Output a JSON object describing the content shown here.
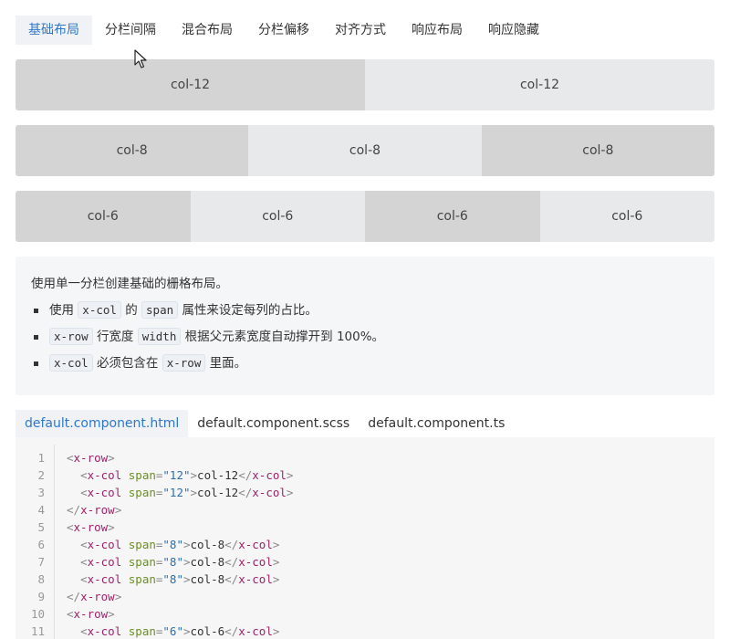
{
  "tabs": [
    "基础布局",
    "分栏间隔",
    "混合布局",
    "分栏偏移",
    "对齐方式",
    "响应布局",
    "响应隐藏"
  ],
  "grid": {
    "row1": [
      "col-12",
      "col-12"
    ],
    "row2": [
      "col-8",
      "col-8",
      "col-8"
    ],
    "row3": [
      "col-6",
      "col-6",
      "col-6",
      "col-6"
    ]
  },
  "description": {
    "intro": "使用单一分栏创建基础的栅格布局。",
    "b1_pre": "使用",
    "b1_code1": "x-col",
    "b1_mid": "的",
    "b1_code2": "span",
    "b1_post": "属性来设定每列的占比。",
    "b2_code1": "x-row",
    "b2_mid": "行宽度",
    "b2_code2": "width",
    "b2_post": "根据父元素宽度自动撑开到 100%。",
    "b3_code1": "x-col",
    "b3_mid": "必须包含在",
    "b3_code2": "x-row",
    "b3_post": "里面。"
  },
  "file_tabs": [
    "default.component.html",
    "default.component.scss",
    "default.component.ts"
  ],
  "code": {
    "line_numbers": [
      "1",
      "2",
      "3",
      "4",
      "5",
      "6",
      "7",
      "8",
      "9",
      "10",
      "11"
    ],
    "lines": [
      "<x-row>",
      "  <x-col span=\"12\">col-12</x-col>",
      "  <x-col span=\"12\">col-12</x-col>",
      "</x-row>",
      "<x-row>",
      "  <x-col span=\"8\">col-8</x-col>",
      "  <x-col span=\"8\">col-8</x-col>",
      "  <x-col span=\"8\">col-8</x-col>",
      "</x-row>",
      "<x-row>",
      "  <x-col span=\"6\">col-6</x-col>"
    ]
  },
  "colors": {
    "accent": "#2f78c9",
    "tag": "#a0216b",
    "attr": "#6b8e23",
    "value": "#2a6fb0"
  },
  "icons": {
    "cursor": "mouse-pointer-icon"
  }
}
